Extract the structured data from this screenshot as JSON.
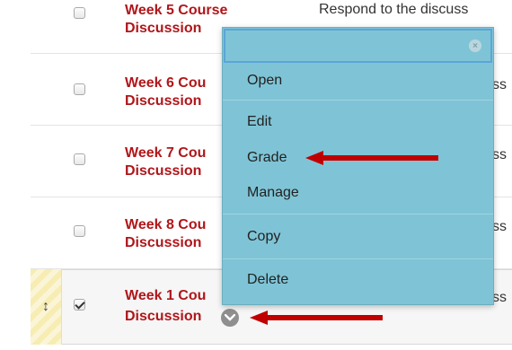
{
  "rows": [
    {
      "title_line1": "Week 5 Course",
      "title_line2": "Discussion",
      "desc": "Respond to the discuss",
      "checked": false
    },
    {
      "title_line1": "Week 6 Cou",
      "title_line2": "Discussion",
      "desc": "ss",
      "checked": false
    },
    {
      "title_line1": "Week 7 Cou",
      "title_line2": "Discussion",
      "desc": "ss",
      "checked": false
    },
    {
      "title_line1": "Week 8 Cou",
      "title_line2": "Discussion",
      "desc": "ss",
      "checked": false
    },
    {
      "title_line1": "Week 1 Cou",
      "title_line2": "Discussion",
      "desc": "ss",
      "checked": true
    }
  ],
  "menu": {
    "search_value": "",
    "items": [
      "Open",
      "Edit",
      "Grade",
      "Manage",
      "Copy",
      "Delete"
    ]
  },
  "colors": {
    "title": "#b0161a",
    "menu_bg": "#7fc4d6",
    "arrow": "#c00000",
    "chevron": "#8f8f8f"
  },
  "icons": {
    "drag_handle": "↕",
    "clear": "×",
    "chevron": "chevron-down-icon"
  }
}
